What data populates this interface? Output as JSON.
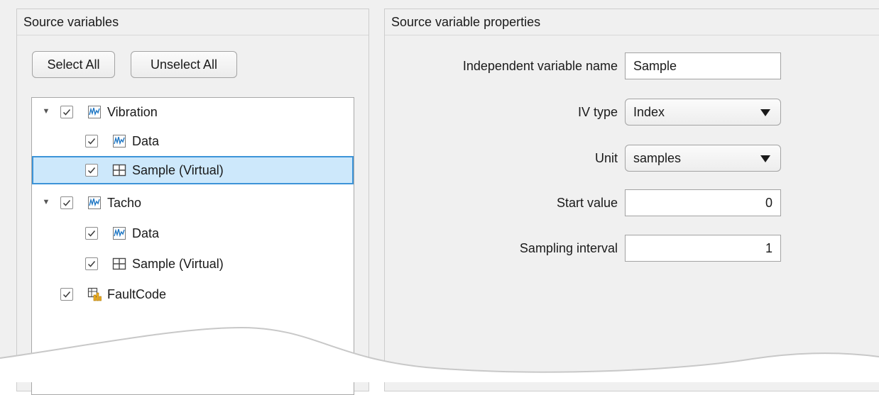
{
  "left_panel": {
    "title": "Source variables",
    "select_all_label": "Select All",
    "unselect_all_label": "Unselect All",
    "tree": [
      {
        "label": "Vibration",
        "checked": true,
        "expanded": true,
        "icon": "signal-icon"
      },
      {
        "label": "Data",
        "checked": true,
        "icon": "signal-icon"
      },
      {
        "label": "Sample (Virtual)",
        "checked": true,
        "icon": "table-icon",
        "selected": true
      },
      {
        "label": "Tacho",
        "checked": true,
        "expanded": true,
        "icon": "signal-icon"
      },
      {
        "label": "Data",
        "checked": true,
        "icon": "signal-icon"
      },
      {
        "label": "Sample (Virtual)",
        "checked": true,
        "icon": "table-icon"
      },
      {
        "label": "FaultCode",
        "checked": true,
        "icon": "categorical-table-icon"
      }
    ]
  },
  "right_panel": {
    "title": "Source variable properties",
    "fields": {
      "iv_name_label": "Independent variable name",
      "iv_name_value": "Sample",
      "iv_type_label": "IV type",
      "iv_type_value": "Index",
      "unit_label": "Unit",
      "unit_value": "samples",
      "start_label": "Start value",
      "start_value": "0",
      "interval_label": "Sampling interval",
      "interval_value": "1"
    }
  },
  "colors": {
    "selection_fill": "#cde8fb",
    "selection_border": "#3d94d8",
    "signal_icon": "#1f77c4",
    "faultcode_accent": "#f2b01e"
  }
}
